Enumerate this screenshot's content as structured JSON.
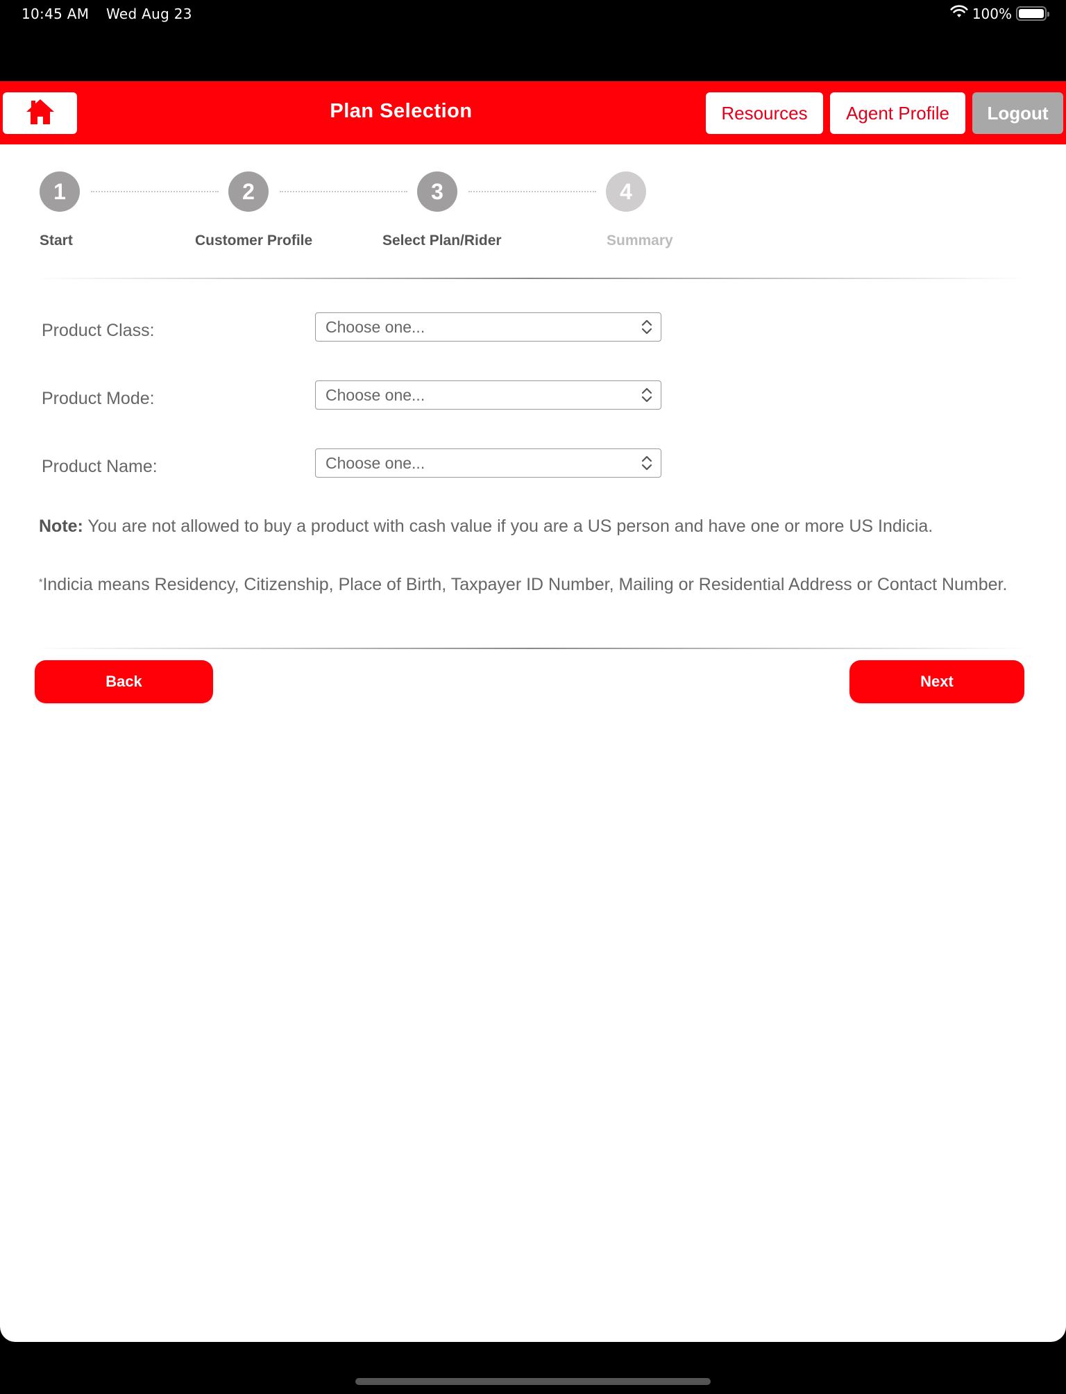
{
  "status_bar": {
    "time": "10:45 AM",
    "date": "Wed Aug 23",
    "battery_percent": "100%",
    "battery_level": 1.0,
    "icons": [
      "wifi-icon",
      "battery-icon"
    ]
  },
  "header": {
    "home_icon": "home-icon",
    "title": "Plan Selection",
    "buttons": {
      "resources": "Resources",
      "agent_profile": "Agent Profile",
      "logout": "Logout"
    },
    "colors": {
      "brand_red": "#ff0009",
      "logout_grey": "#a9a8a8"
    }
  },
  "stepper": {
    "current_step": 3,
    "steps": [
      {
        "number": "1",
        "label": "Start",
        "state": "done"
      },
      {
        "number": "2",
        "label": "Customer Profile",
        "state": "done"
      },
      {
        "number": "3",
        "label": "Select Plan/Rider",
        "state": "current"
      },
      {
        "number": "4",
        "label": "Summary",
        "state": "future"
      }
    ]
  },
  "form": {
    "fields": [
      {
        "label": "Product Class:",
        "value": "Choose one..."
      },
      {
        "label": "Product Mode:",
        "value": "Choose one..."
      },
      {
        "label": "Product Name:",
        "value": "Choose one..."
      }
    ]
  },
  "notes": {
    "note_label": "Note:",
    "note_text": " You are not allowed to buy a product with cash value if you are a US person and have one or more US Indicia.",
    "footnote_marker": "*",
    "footnote_text": "Indicia means Residency, Citizenship, Place of Birth, Taxpayer ID Number, Mailing or Residential Address or Contact Number."
  },
  "actions": {
    "back": "Back",
    "next": "Next"
  }
}
